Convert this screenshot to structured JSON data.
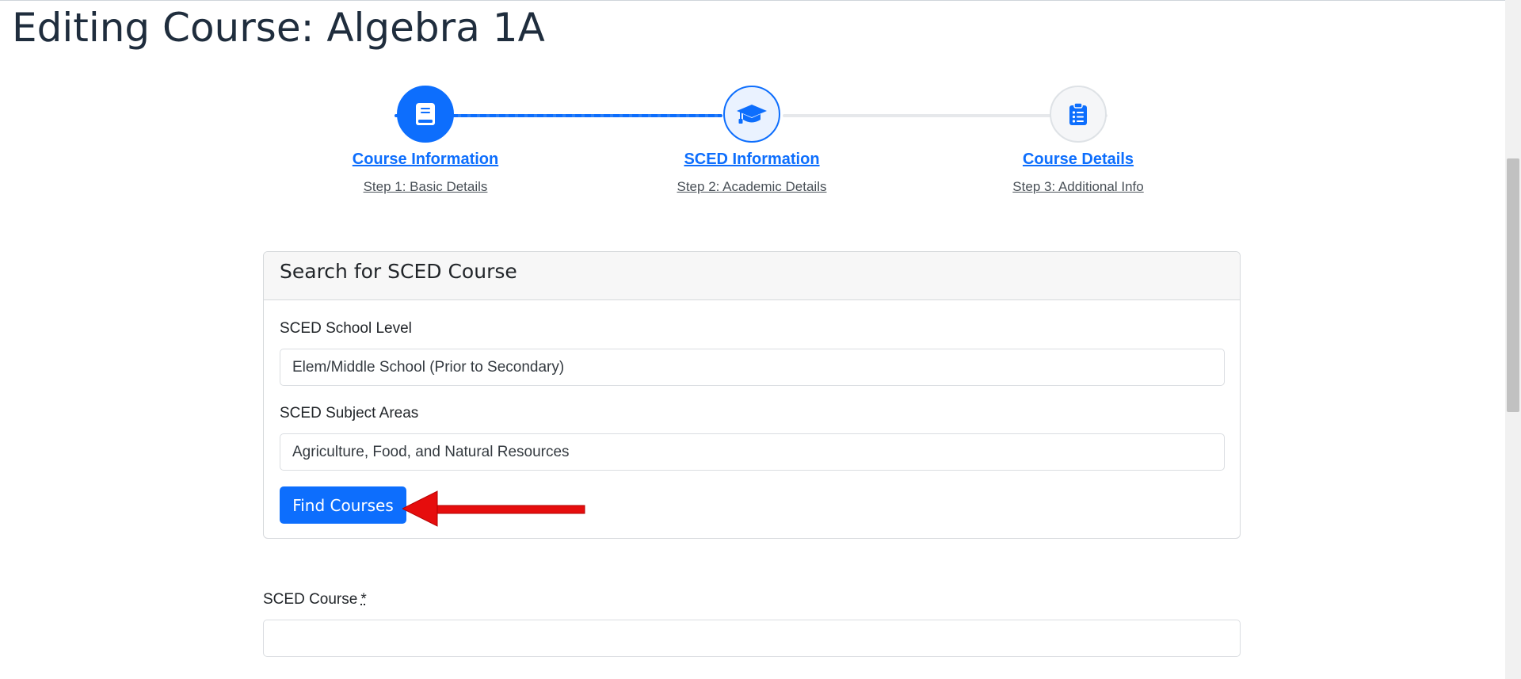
{
  "page": {
    "title": "Editing Course: Algebra 1A"
  },
  "stepper": {
    "steps": [
      {
        "title": "Course Information",
        "subtitle": "Step 1: Basic Details",
        "icon": "book-icon",
        "state": "completed"
      },
      {
        "title": "SCED Information",
        "subtitle": "Step 2: Academic Details",
        "icon": "graduation-cap-icon",
        "state": "current"
      },
      {
        "title": "Course Details",
        "subtitle": "Step 3: Additional Info",
        "icon": "clipboard-list-icon",
        "state": "upcoming"
      }
    ]
  },
  "search_card": {
    "title": "Search for SCED Course",
    "school_level": {
      "label": "SCED School Level",
      "value": "Elem/Middle School (Prior to Secondary)"
    },
    "subject_areas": {
      "label": "SCED Subject Areas",
      "value": "Agriculture, Food, and Natural Resources"
    },
    "find_button": "Find Courses"
  },
  "sced_course": {
    "label": "SCED Course",
    "required_mark": "*",
    "value": ""
  },
  "colors": {
    "primary": "#0d6efd",
    "arrow": "#e60d0d",
    "heading": "#1f2d3d"
  }
}
